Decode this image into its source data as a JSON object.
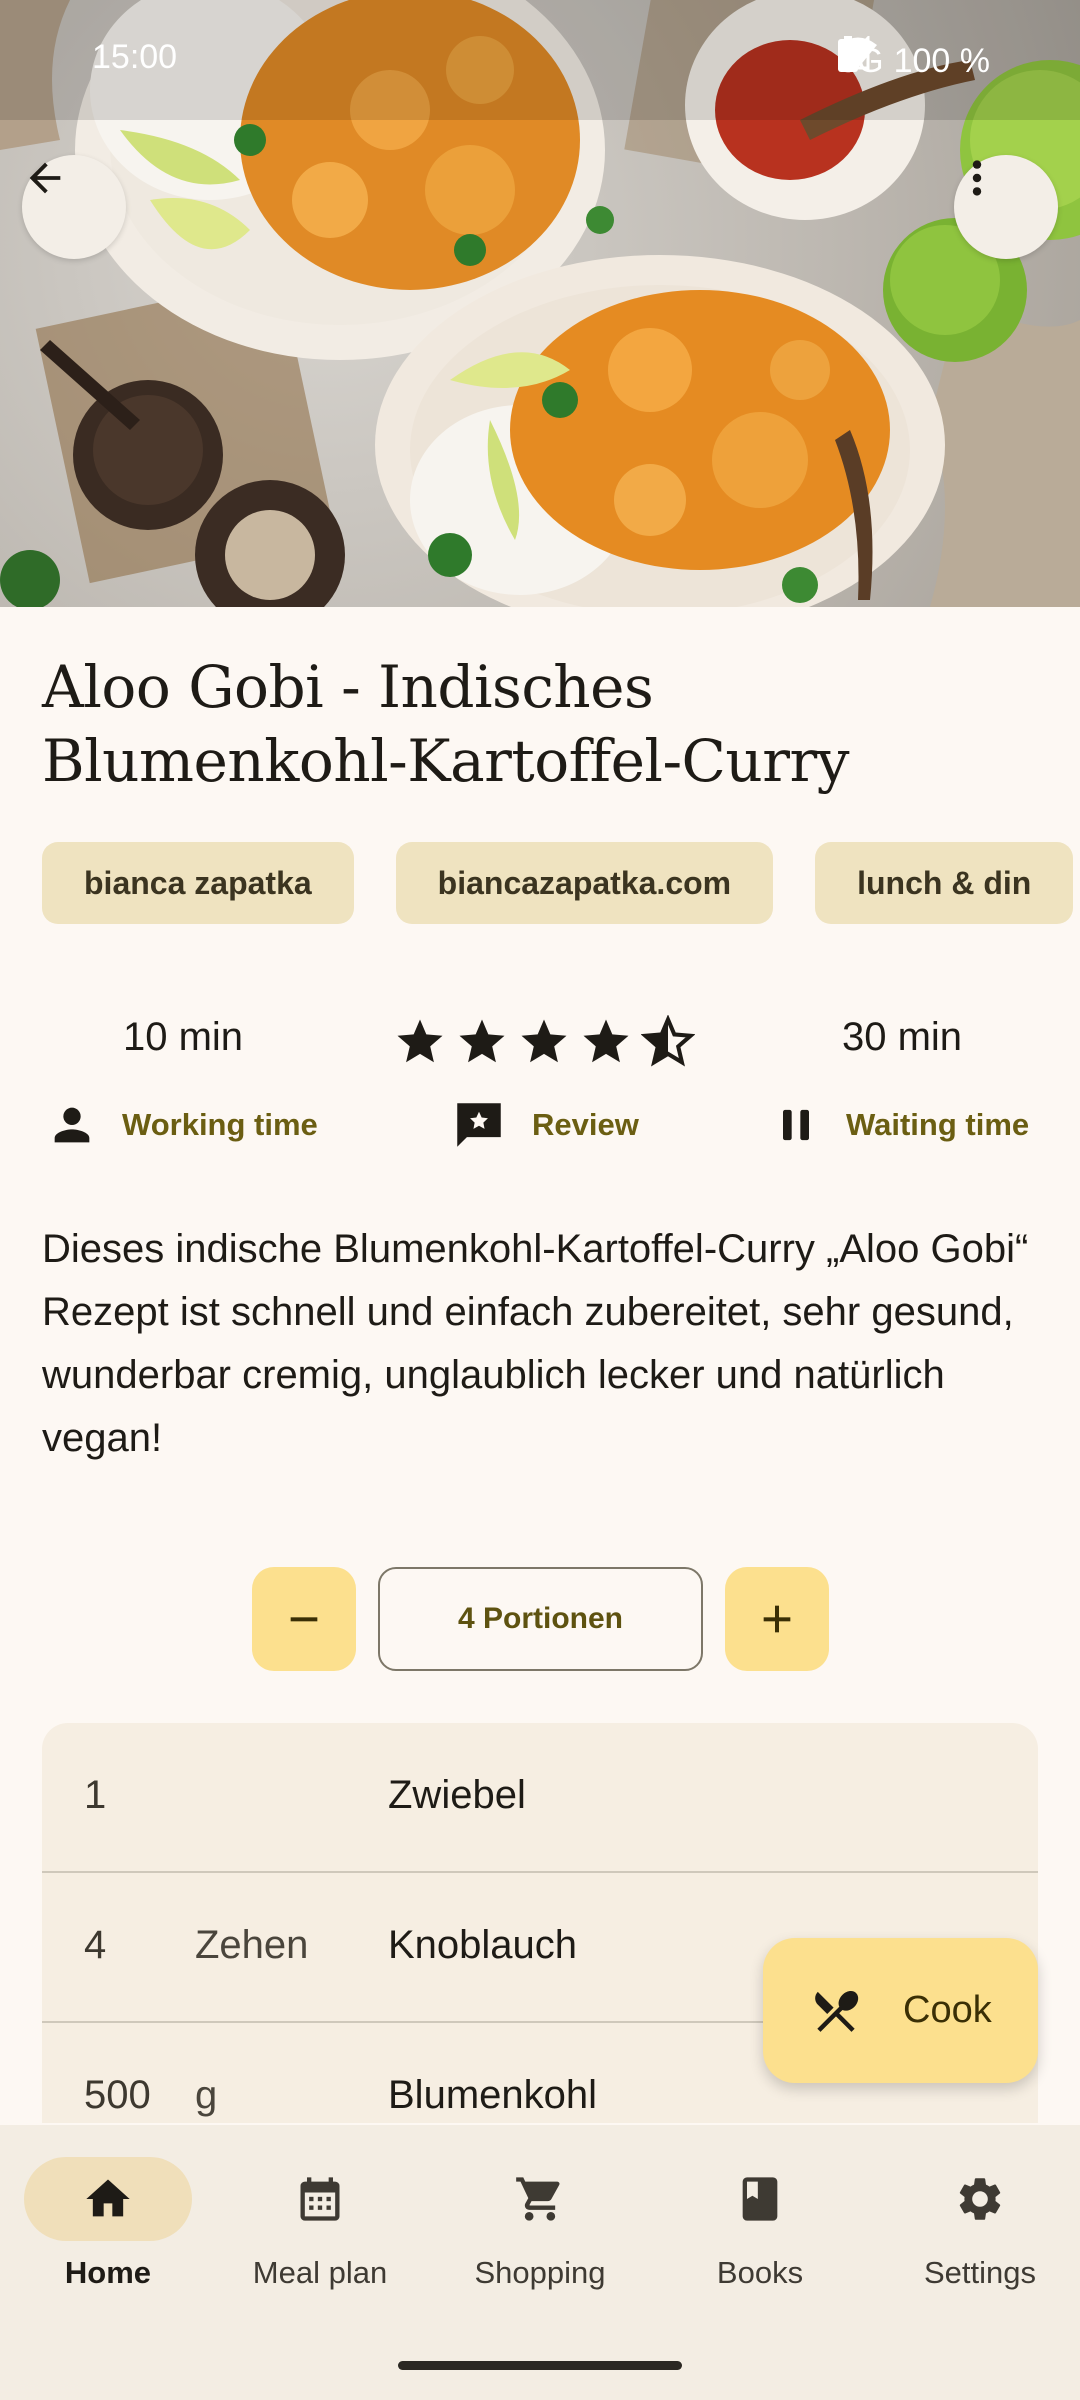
{
  "status_bar": {
    "time": "15:00",
    "network": "3G",
    "battery": "100 %"
  },
  "header": {
    "back_icon": "arrow-back-icon",
    "more_icon": "more-vert-icon"
  },
  "recipe": {
    "title_line1": "Aloo Gobi - Indisches",
    "title_line2": "Blumenkohl-Kartoffel-Curry",
    "chips": [
      "bianca zapatka",
      "biancazapatka.com",
      "lunch & din"
    ],
    "working_time_value": "10 min",
    "working_time_label": "Working time",
    "rating": 4.5,
    "review_label": "Review",
    "waiting_time_value": "30 min",
    "waiting_time_label": "Waiting time",
    "description": "Dieses indische Blumenkohl-Kartoffel-Curry „Aloo Gobi“ Rezept ist schnell und einfach zubereitet, sehr gesund, wunderbar cremig, unglaublich lecker und natürlich vegan!",
    "portions_label": "4 Portionen"
  },
  "ingredients": [
    {
      "amount": "1",
      "unit": "",
      "name": "Zwiebel"
    },
    {
      "amount": "4",
      "unit": "Zehen",
      "name": "Knoblauch"
    },
    {
      "amount": "500",
      "unit": "g",
      "name": "Blumenkohl"
    }
  ],
  "fab": {
    "label": "Cook",
    "icon": "restaurant-icon"
  },
  "bottom_nav": [
    {
      "label": "Home",
      "icon": "home-icon",
      "active": true
    },
    {
      "label": "Meal plan",
      "icon": "calendar-icon",
      "active": false
    },
    {
      "label": "Shopping",
      "icon": "cart-icon",
      "active": false
    },
    {
      "label": "Books",
      "icon": "book-icon",
      "active": false
    },
    {
      "label": "Settings",
      "icon": "gear-icon",
      "active": false
    }
  ],
  "colors": {
    "background": "#FDF8F3",
    "chip": "#EFE3C0",
    "accent_container": "#FCE08E",
    "accent_text": "#6B5E12",
    "nav_background": "#F3EDE3",
    "nav_active_pill": "#F0DFBA"
  }
}
